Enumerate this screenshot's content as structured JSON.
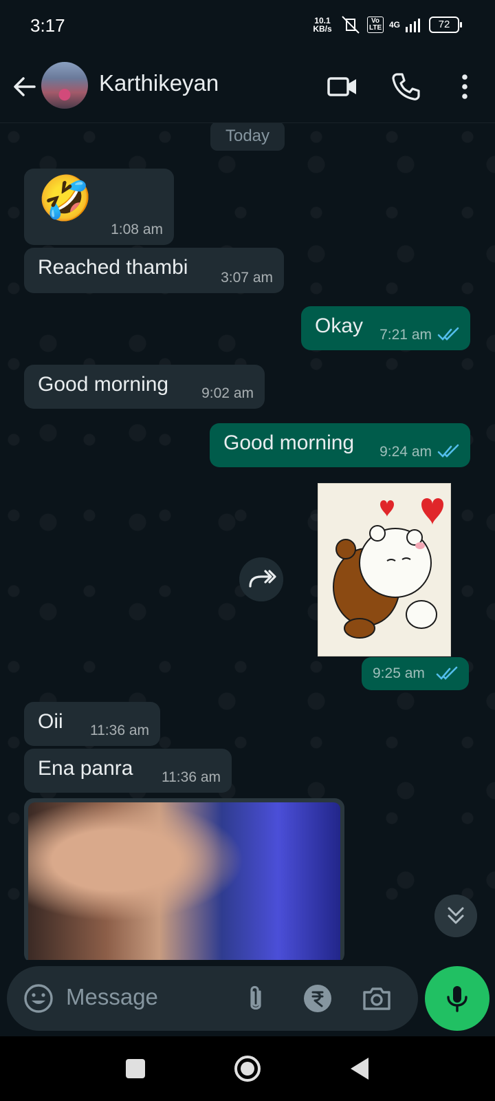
{
  "status_bar": {
    "time": "3:17",
    "net_speed": "10.1",
    "net_unit": "KB/s",
    "network": "4G",
    "volte": "Vo LTE",
    "battery": "72"
  },
  "header": {
    "contact_name": "Karthikeyan",
    "icons": [
      "back-arrow-icon",
      "video-call-icon",
      "phone-icon",
      "more-options-icon"
    ]
  },
  "chat": {
    "date_chip": "Today",
    "messages": [
      {
        "dir": "in",
        "text": "🤣",
        "time": "1:08 am"
      },
      {
        "dir": "in",
        "text": "Reached thambi",
        "time": "3:07 am"
      },
      {
        "dir": "out",
        "text": "Okay",
        "time": "7:21 am",
        "status": "read"
      },
      {
        "dir": "in",
        "text": "Good morning",
        "time": "9:02 am"
      },
      {
        "dir": "out",
        "text": "Good morning",
        "time": "9:24 am",
        "status": "read"
      },
      {
        "dir": "out",
        "text": "",
        "media": "sticker-bears-hug",
        "time": "9:25 am",
        "status": "read"
      },
      {
        "dir": "in",
        "text": "Oii",
        "time": "11:36 am"
      },
      {
        "dir": "in",
        "text": "Ena panra",
        "time": "11:36 am"
      },
      {
        "dir": "in",
        "text": "",
        "media": "photo-selfie"
      }
    ]
  },
  "input": {
    "placeholder": "Message",
    "icons": [
      "emoji-icon",
      "attach-icon",
      "rupee-payment-icon",
      "camera-icon",
      "mic-icon"
    ]
  },
  "colors": {
    "background": "#0b141a",
    "incoming_bubble": "#202c33",
    "outgoing_bubble": "#005c4b",
    "read_ticks": "#53bdeb",
    "mic_button": "#21c063"
  }
}
